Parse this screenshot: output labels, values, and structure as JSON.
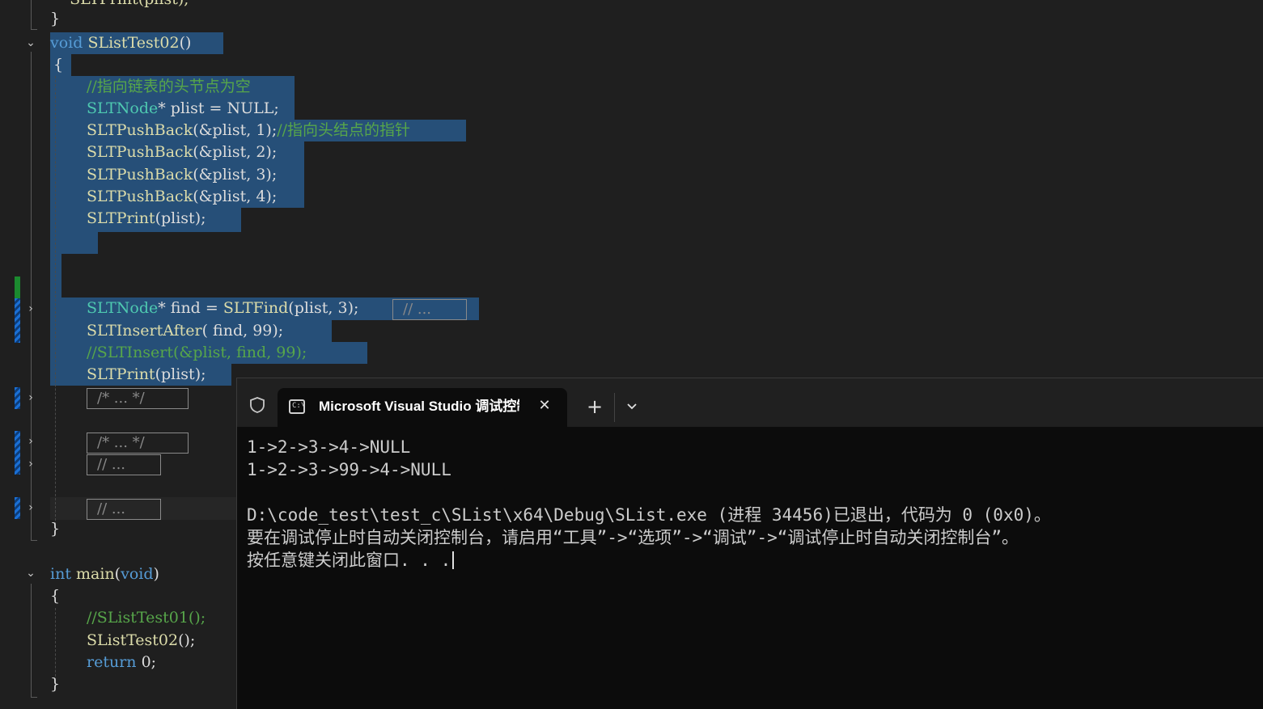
{
  "editor": {
    "lines": {
      "l0": "    SLTPrint(plist);",
      "l1": "}",
      "l2_kw": "void",
      "l2_fn": "SListTest02",
      "l2_rest": "()",
      "l3": "{",
      "l4": "//指向链表的头节点为空",
      "l5_ty": "SLTNode",
      "l5_rest": "* plist = NULL;",
      "l6_fn": "SLTPushBack",
      "l6_rest": "(&plist, 1);",
      "l6_cm": "//指向头结点的指针",
      "l7_fn": "SLTPushBack",
      "l7_rest": "(&plist, 2);",
      "l8_fn": "SLTPushBack",
      "l8_rest": "(&plist, 3);",
      "l9_fn": "SLTPushBack",
      "l9_rest": "(&plist, 4);",
      "l10_fn": "SLTPrint",
      "l10_rest": "(plist);",
      "l13_ty": "SLTNode",
      "l13_a": "* find = ",
      "l13_fn": "SLTFind",
      "l13_b": "(plist, 3);",
      "l13_collapsed": "// ...",
      "l14_fn": "SLTInsertAfter",
      "l14_rest": "( find, 99);",
      "l15": "//SLTInsert(&plist, find, 99);",
      "l16_fn": "SLTPrint",
      "l16_rest": "(plist);",
      "c1": "/* ... */",
      "c2": "/* ... */",
      "c3": "// ...",
      "c4": "// ...",
      "close1": "}",
      "main_kw": "int",
      "main_fn": "main",
      "main_paren": "(",
      "main_void": "void",
      "main_close": ")",
      "main_open": "{",
      "main_cm": "//SListTest01();",
      "main_call_fn": "SListTest02",
      "main_call_rest": "();",
      "main_ret_kw": "return",
      "main_ret_rest": " 0;",
      "main_end": "}"
    }
  },
  "terminal": {
    "tab_title": "Microsoft Visual Studio 调试控制台",
    "tab_icon_text": "C:\\",
    "close_glyph": "✕",
    "new_tab_glyph": "+",
    "output": [
      "1->2->3->4->NULL",
      "1->2->3->99->4->NULL",
      "",
      "D:\\code_test\\test_c\\SList\\x64\\Debug\\SList.exe (进程 34456)已退出，代码为 0 (0x0)。",
      "要在调试停止时自动关闭控制台，请启用“工具”->“选项”->“调试”->“调试停止时自动关闭控制台”。",
      "按任意键关闭此窗口. . ."
    ]
  },
  "colors": {
    "editor_bg": "#1f1f1f",
    "selection": "#264f78",
    "keyword": "#569cd6",
    "type": "#4ec9b0",
    "function": "#dcdcaa",
    "comment": "#57a64a",
    "terminal_bg": "#0c0c0c"
  }
}
